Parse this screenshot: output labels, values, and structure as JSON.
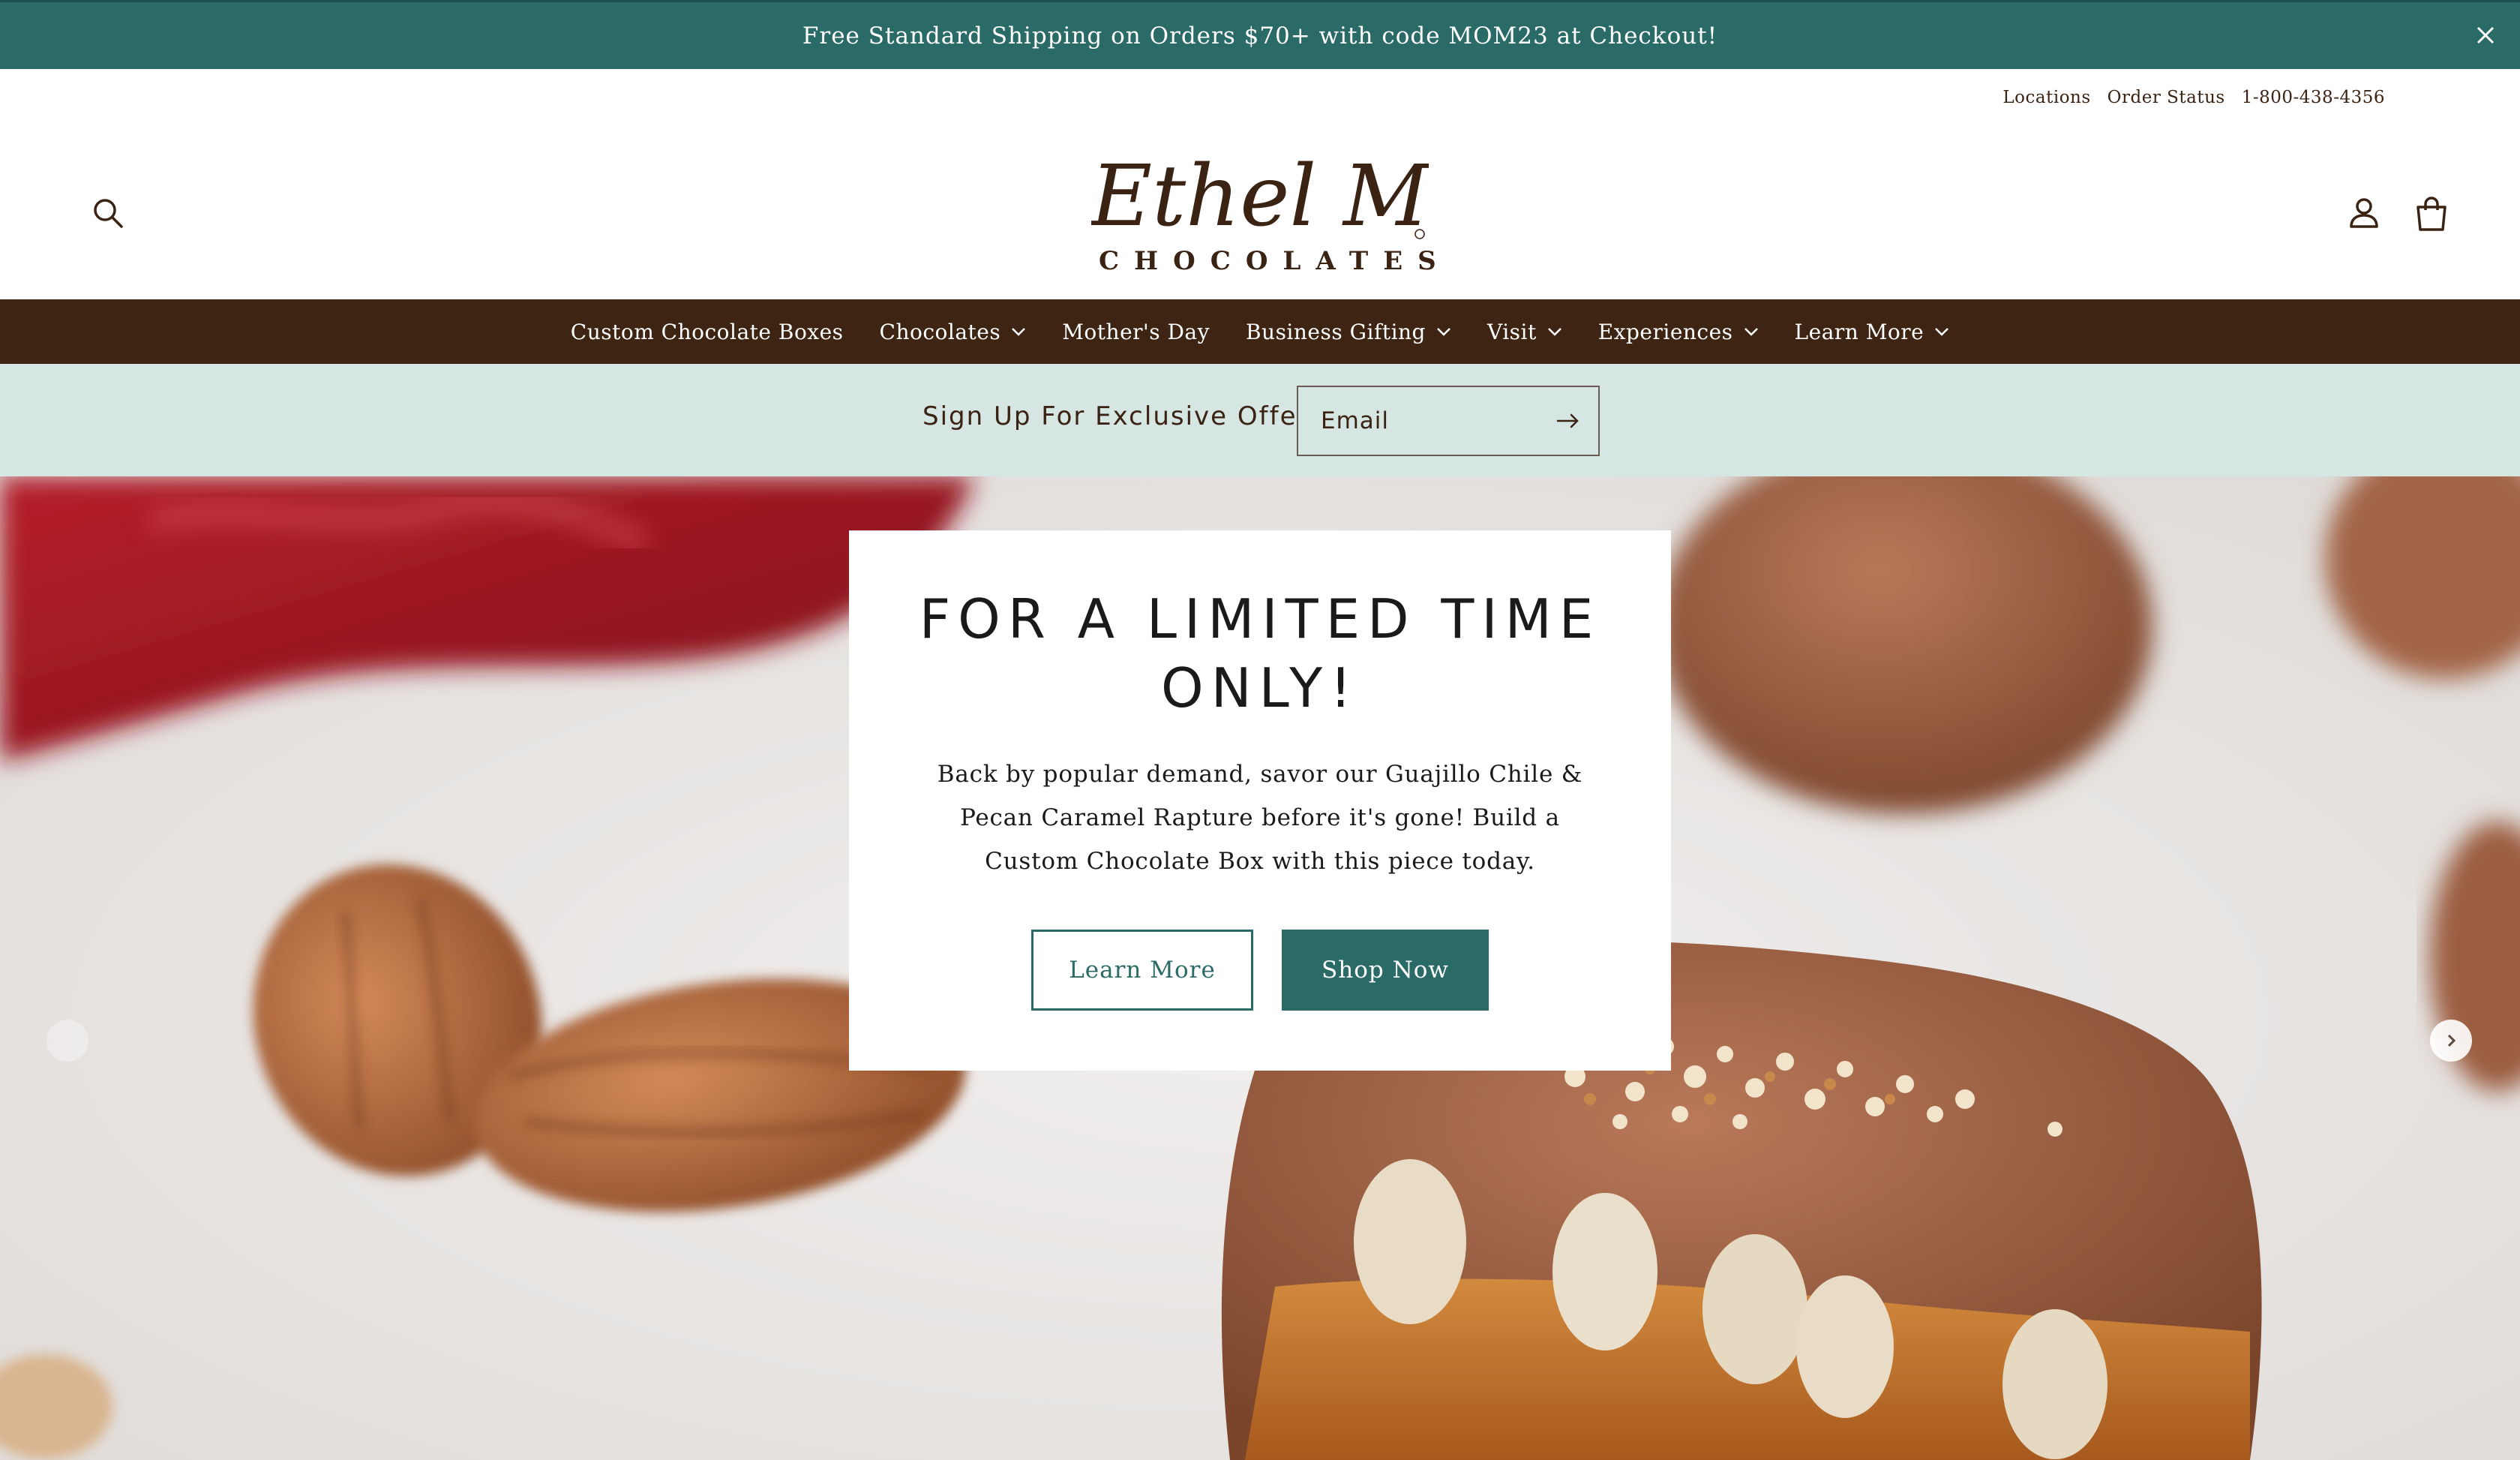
{
  "announcement": {
    "text": "Free Standard Shipping on Orders $70+ with code MOM23 at Checkout!",
    "close_icon": "close-icon"
  },
  "utility_links": [
    "Locations",
    "Order Status",
    "1-800-438-4356"
  ],
  "header": {
    "logo_script": "Ethel M",
    "logo_word": "CHOCOLATES",
    "icons": [
      "search-icon",
      "account-icon",
      "cart-icon"
    ]
  },
  "nav": {
    "items": [
      {
        "label": "Custom Chocolate Boxes",
        "dropdown": false
      },
      {
        "label": "Chocolates",
        "dropdown": true
      },
      {
        "label": "Mother's Day",
        "dropdown": false
      },
      {
        "label": "Business Gifting",
        "dropdown": true
      },
      {
        "label": "Visit",
        "dropdown": true
      },
      {
        "label": "Experiences",
        "dropdown": true
      },
      {
        "label": "Learn More",
        "dropdown": true
      }
    ]
  },
  "signup": {
    "label": "Sign Up For Exclusive Offers",
    "placeholder": "Email",
    "submit_icon": "arrow-right-icon"
  },
  "hero": {
    "heading": "FOR A LIMITED TIME ONLY!",
    "body": "Back by popular demand, savor our Guajillo Chile & Pecan Caramel Rapture before it's gone! Build a Custom Chocolate Box with this piece today.",
    "primary_button": "Shop Now",
    "secondary_button": "Learn More",
    "slider_icons": [
      "chevron-left-icon",
      "chevron-right-icon"
    ]
  },
  "colors": {
    "teal": "#2a6a67",
    "brown": "#3e2412",
    "mint": "#d6e7e3",
    "white": "#ffffff"
  }
}
